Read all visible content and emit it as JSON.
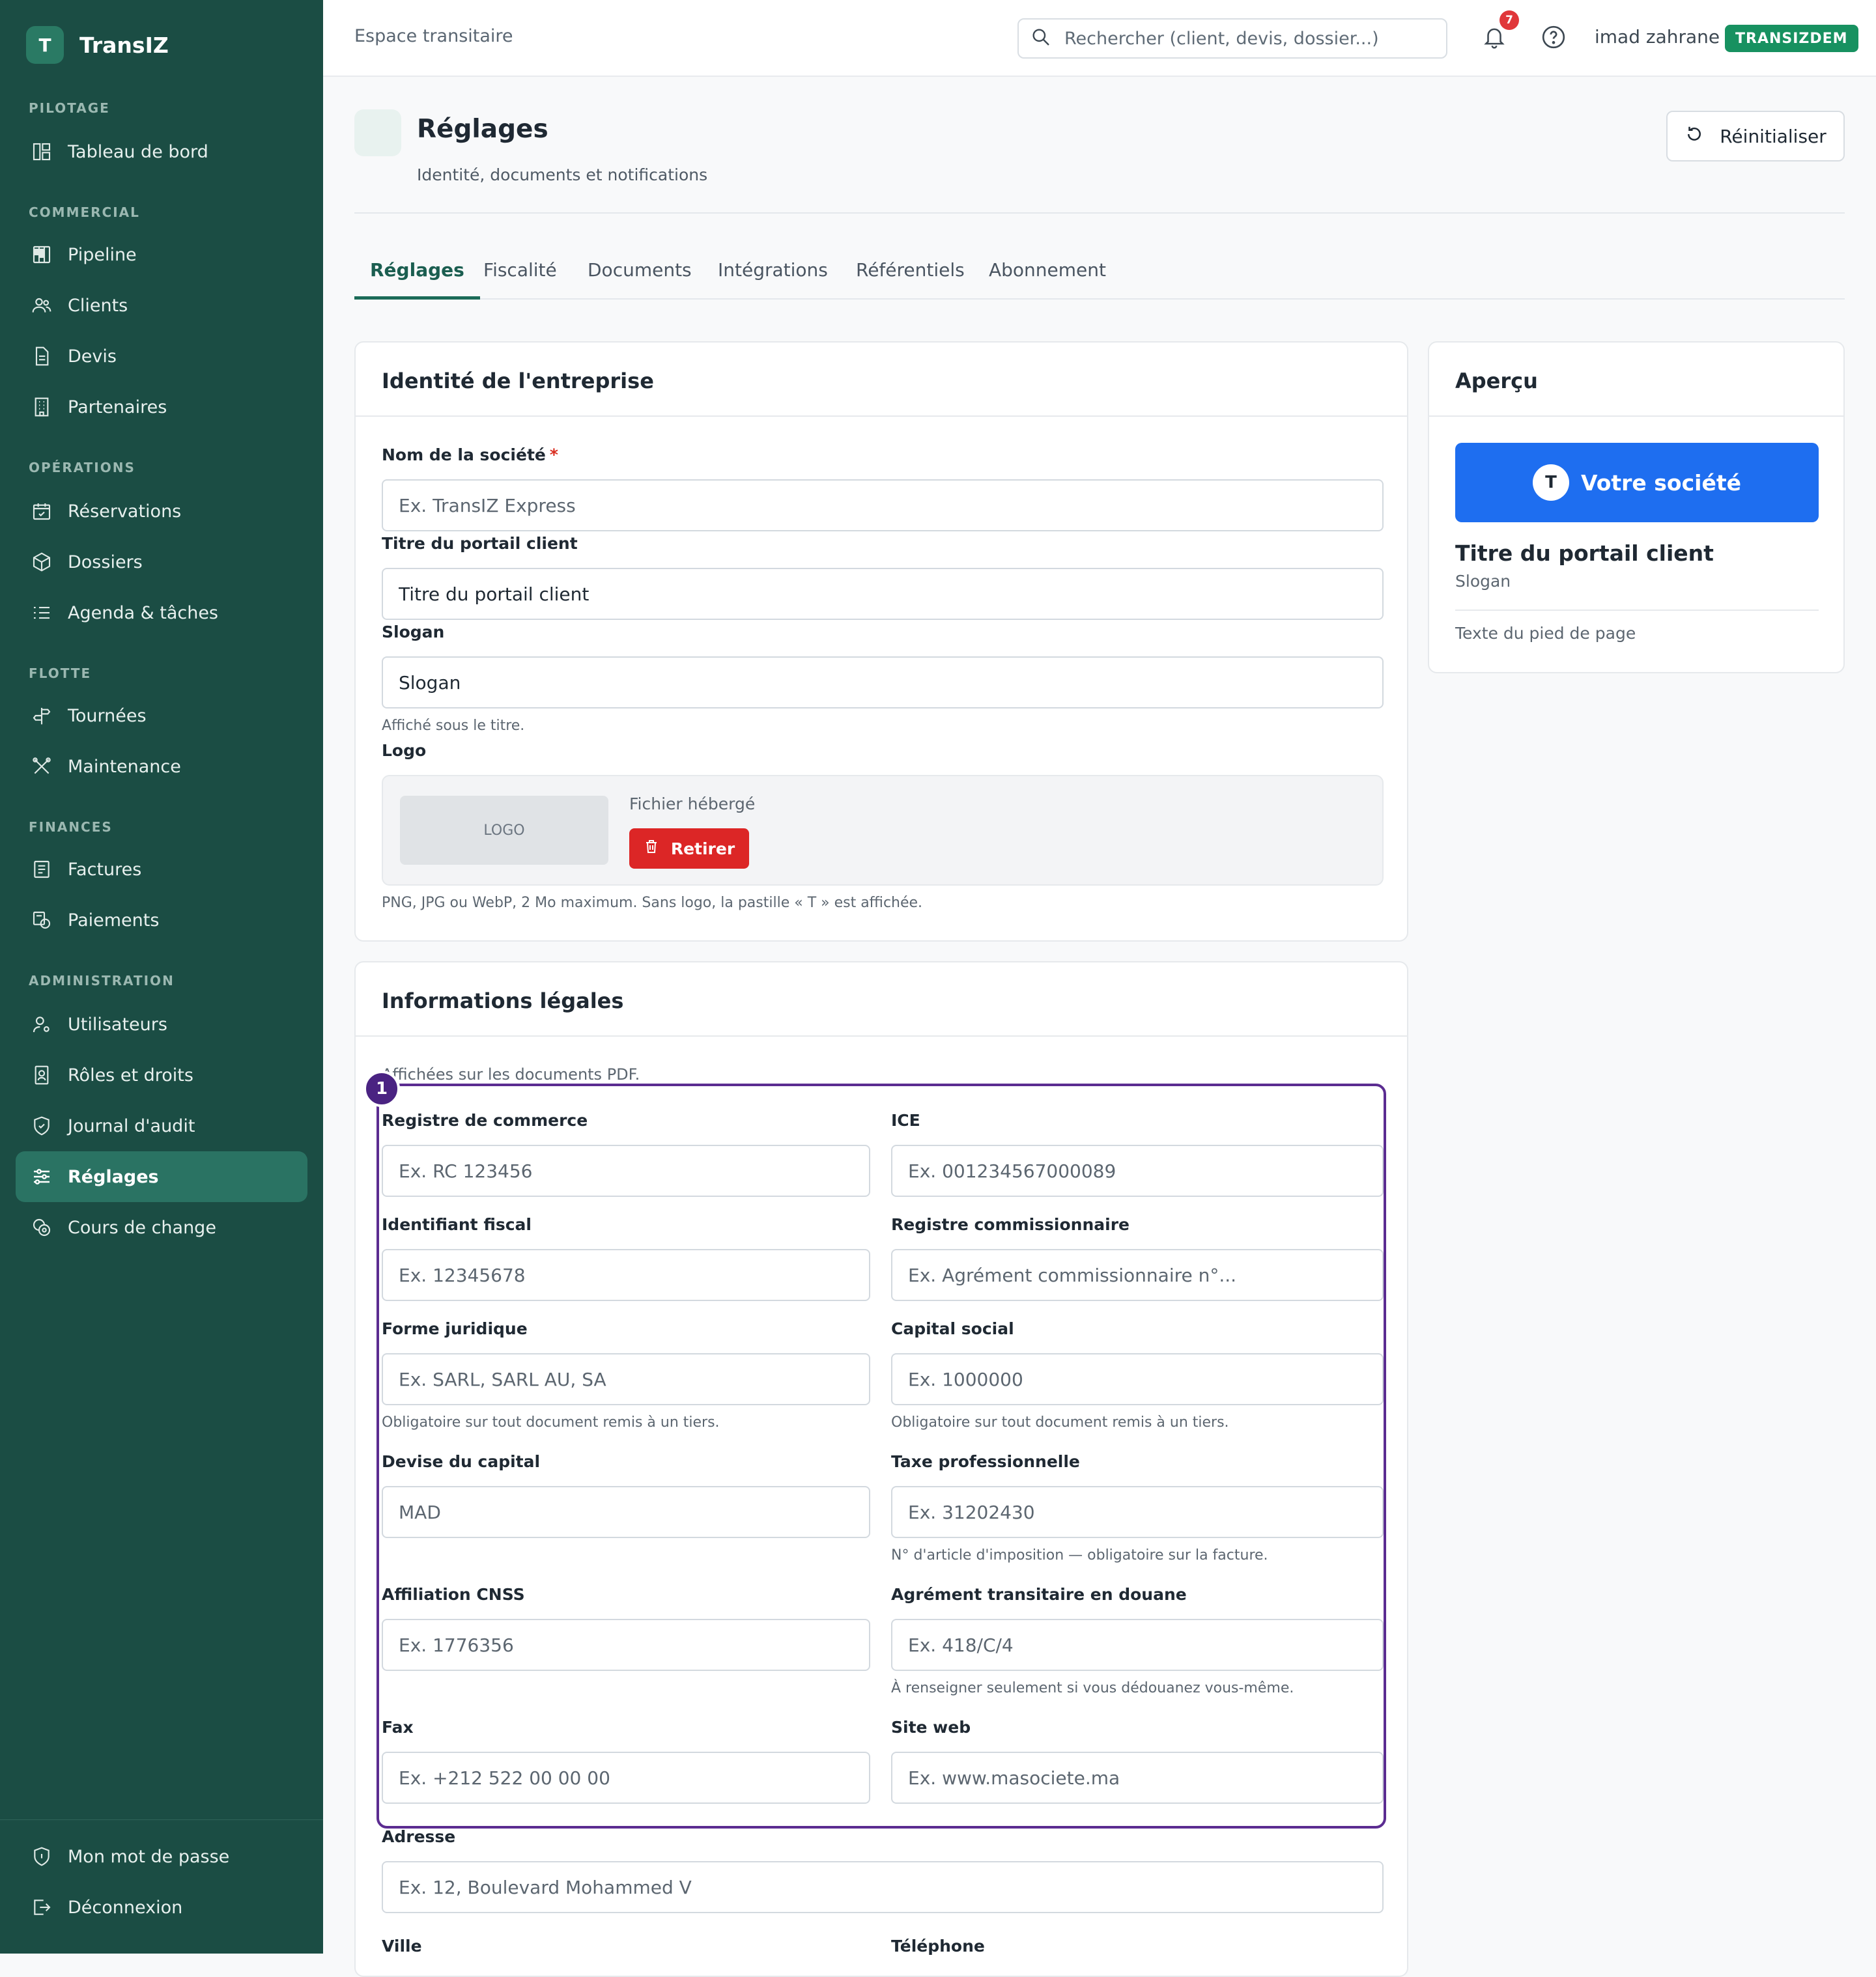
{
  "app": {
    "name": "TransIZ",
    "logo_letter": "T"
  },
  "sidebar": {
    "sections": [
      {
        "title": "PILOTAGE",
        "items": [
          {
            "label": "Tableau de bord",
            "icon": "dashboard-icon"
          }
        ]
      },
      {
        "title": "COMMERCIAL",
        "items": [
          {
            "label": "Pipeline",
            "icon": "kanban-icon"
          },
          {
            "label": "Clients",
            "icon": "users-icon"
          },
          {
            "label": "Devis",
            "icon": "document-icon"
          },
          {
            "label": "Partenaires",
            "icon": "building-icon"
          }
        ]
      },
      {
        "title": "OPÉRATIONS",
        "items": [
          {
            "label": "Réservations",
            "icon": "calendar-check-icon"
          },
          {
            "label": "Dossiers",
            "icon": "box-icon"
          },
          {
            "label": "Agenda & tâches",
            "icon": "list-check-icon"
          }
        ]
      },
      {
        "title": "FLOTTE",
        "items": [
          {
            "label": "Tournées",
            "icon": "signpost-icon"
          },
          {
            "label": "Maintenance",
            "icon": "tools-icon"
          }
        ]
      },
      {
        "title": "FINANCES",
        "items": [
          {
            "label": "Factures",
            "icon": "receipt-icon"
          },
          {
            "label": "Paiements",
            "icon": "payment-icon"
          }
        ]
      },
      {
        "title": "ADMINISTRATION",
        "items": [
          {
            "label": "Utilisateurs",
            "icon": "user-cog-icon"
          },
          {
            "label": "Rôles et droits",
            "icon": "id-badge-icon"
          },
          {
            "label": "Journal d'audit",
            "icon": "shield-icon"
          },
          {
            "label": "Réglages",
            "icon": "sliders-icon",
            "active": true
          },
          {
            "label": "Cours de change",
            "icon": "coins-icon"
          }
        ]
      }
    ],
    "footer": [
      {
        "label": "Mon mot de passe",
        "icon": "shield-lock-icon"
      },
      {
        "label": "Déconnexion",
        "icon": "logout-icon"
      }
    ]
  },
  "topbar": {
    "title": "Espace transitaire",
    "search_placeholder": "Rechercher (client, devis, dossier...)",
    "notification_count": "7",
    "user_name": "imad zahrane",
    "tenant": "TRANSIZDEM"
  },
  "page": {
    "title": "Réglages",
    "subtitle": "Identité, documents et notifications",
    "reset_label": "Réinitialiser"
  },
  "tabs": [
    "Réglages",
    "Fiscalité",
    "Documents",
    "Intégrations",
    "Référentiels",
    "Abonnement"
  ],
  "identity": {
    "title": "Identité de l'entreprise",
    "company_label": "Nom de la société",
    "required_mark": "*",
    "company_placeholder": "Ex. TransIZ Express",
    "portal_title_label": "Titre du portail client",
    "portal_title_value": "Titre du portail client",
    "slogan_label": "Slogan",
    "slogan_value": "Slogan",
    "slogan_hint": "Affiché sous le titre.",
    "logo_label": "Logo",
    "logo_placeholder": "LOGO",
    "logo_file": "Fichier hébergé",
    "remove_label": "Retirer",
    "logo_hint": "PNG, JPG ou WebP, 2 Mo maximum. Sans logo, la pastille « T » est affichée."
  },
  "legal": {
    "title": "Informations légales",
    "subtitle": "Affichées sur les documents PDF.",
    "marker": "1",
    "fields": [
      {
        "label": "Registre de commerce",
        "placeholder": "Ex. RC 123456"
      },
      {
        "label": "ICE",
        "placeholder": "Ex. 001234567000089"
      },
      {
        "label": "Identifiant fiscal",
        "placeholder": "Ex. 12345678"
      },
      {
        "label": "Registre commissionnaire",
        "placeholder": "Ex. Agrément commissionnaire n°..."
      },
      {
        "label": "Forme juridique",
        "placeholder": "Ex. SARL, SARL AU, SA",
        "hint": "Obligatoire sur tout document remis à un tiers."
      },
      {
        "label": "Capital social",
        "placeholder": "Ex. 1000000",
        "hint": "Obligatoire sur tout document remis à un tiers."
      },
      {
        "label": "Devise du capital",
        "placeholder": "MAD"
      },
      {
        "label": "Taxe professionnelle",
        "placeholder": "Ex. 31202430",
        "hint": "N° d'article d'imposition — obligatoire sur la facture."
      },
      {
        "label": "Affiliation CNSS",
        "placeholder": "Ex. 1776356"
      },
      {
        "label": "Agrément transitaire en douane",
        "placeholder": "Ex. 418/C/4",
        "hint": "À renseigner seulement si vous dédouanez vous-même."
      },
      {
        "label": "Fax",
        "placeholder": "Ex. +212 522 00 00 00"
      },
      {
        "label": "Site web",
        "placeholder": "Ex. www.masociete.ma"
      }
    ],
    "address_label": "Adresse",
    "address_placeholder": "Ex. 12, Boulevard Mohammed V",
    "city_label": "Ville",
    "phone_label": "Téléphone"
  },
  "preview": {
    "title": "Aperçu",
    "brand_letter": "T",
    "brand_name": "Votre société",
    "portal_title": "Titre du portail client",
    "slogan": "Slogan",
    "footer_text": "Texte du pied de page"
  }
}
